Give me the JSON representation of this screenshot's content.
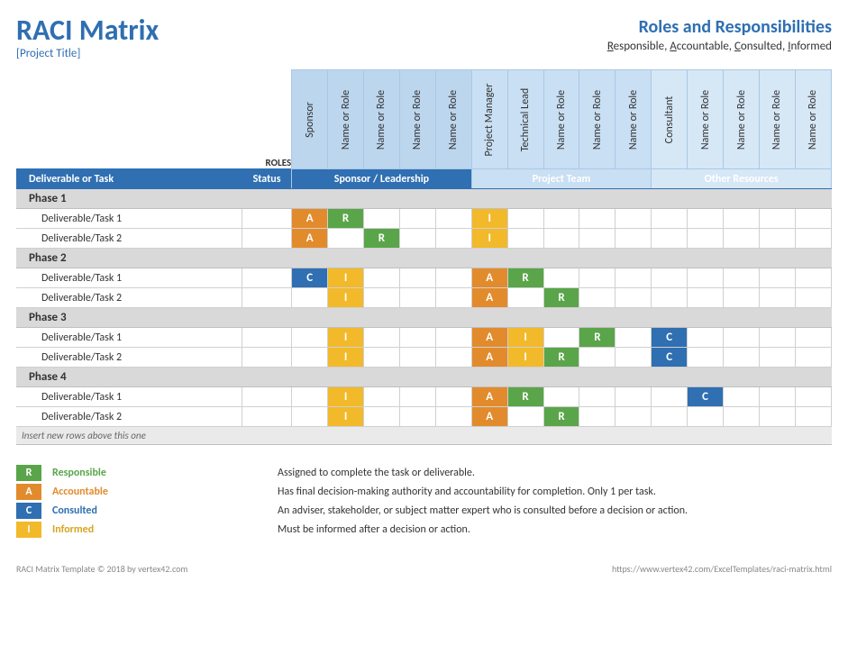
{
  "header": {
    "title": "RACI Matrix",
    "project": "[Project Title]",
    "subtitle": "Roles and Responsibilities",
    "legend_inline_html": "Responsible, Accountable, Consulted, Informed"
  },
  "roles_label": "ROLES",
  "columns": {
    "task": "Deliverable or Task",
    "status": "Status"
  },
  "groups": [
    {
      "label": "Sponsor / Leadership",
      "roles": [
        "Sponsor",
        "Name or Role",
        "Name or Role",
        "Name or Role",
        "Name or Role"
      ]
    },
    {
      "label": "Project Team",
      "roles": [
        "Project Manager",
        "Technical Lead",
        "Name or Role",
        "Name or Role",
        "Name or Role"
      ]
    },
    {
      "label": "Other Resources",
      "roles": [
        "Consultant",
        "Name or Role",
        "Name or Role",
        "Name or Role",
        "Name or Role"
      ]
    }
  ],
  "phases": [
    {
      "name": "Phase 1",
      "tasks": [
        {
          "name": "Deliverable/Task 1",
          "cells": [
            "A",
            "R",
            "",
            "",
            "",
            "I",
            "",
            "",
            "",
            "",
            "",
            "",
            "",
            "",
            ""
          ]
        },
        {
          "name": "Deliverable/Task 2",
          "cells": [
            "A",
            "",
            "R",
            "",
            "",
            "I",
            "",
            "",
            "",
            "",
            "",
            "",
            "",
            "",
            ""
          ]
        }
      ]
    },
    {
      "name": "Phase 2",
      "tasks": [
        {
          "name": "Deliverable/Task 1",
          "cells": [
            "C",
            "I",
            "",
            "",
            "",
            "A",
            "R",
            "",
            "",
            "",
            "",
            "",
            "",
            "",
            ""
          ]
        },
        {
          "name": "Deliverable/Task 2",
          "cells": [
            "",
            "I",
            "",
            "",
            "",
            "A",
            "",
            "R",
            "",
            "",
            "",
            "",
            "",
            "",
            ""
          ]
        }
      ]
    },
    {
      "name": "Phase 3",
      "tasks": [
        {
          "name": "Deliverable/Task 1",
          "cells": [
            "",
            "I",
            "",
            "",
            "",
            "A",
            "I",
            "",
            "R",
            "",
            "C",
            "",
            "",
            "",
            ""
          ]
        },
        {
          "name": "Deliverable/Task 2",
          "cells": [
            "",
            "I",
            "",
            "",
            "",
            "A",
            "I",
            "R",
            "",
            "",
            "C",
            "",
            "",
            "",
            ""
          ]
        }
      ]
    },
    {
      "name": "Phase 4",
      "tasks": [
        {
          "name": "Deliverable/Task 1",
          "cells": [
            "",
            "I",
            "",
            "",
            "",
            "A",
            "R",
            "",
            "",
            "",
            "",
            "C",
            "",
            "",
            ""
          ]
        },
        {
          "name": "Deliverable/Task 2",
          "cells": [
            "",
            "I",
            "",
            "",
            "",
            "A",
            "",
            "R",
            "",
            "",
            "",
            "",
            "",
            "",
            ""
          ]
        }
      ]
    }
  ],
  "insert_hint": "Insert new rows above this one",
  "legend": [
    {
      "code": "R",
      "name": "Responsible",
      "desc": "Assigned to complete the task or deliverable."
    },
    {
      "code": "A",
      "name": "Accountable",
      "desc": "Has final decision-making authority and accountability for completion. Only 1 per task."
    },
    {
      "code": "C",
      "name": "Consulted",
      "desc": "An adviser, stakeholder, or subject matter expert who is consulted before a decision or action."
    },
    {
      "code": "I",
      "name": "Informed",
      "desc": "Must be informed after a decision or action."
    }
  ],
  "footer": {
    "left": "RACI Matrix Template © 2018 by vertex42.com",
    "right": "https://www.vertex42.com/ExcelTemplates/raci-matrix.html"
  }
}
